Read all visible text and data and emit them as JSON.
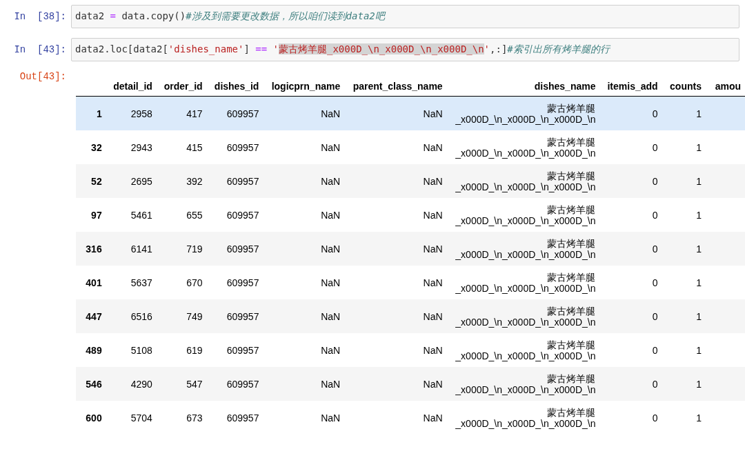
{
  "cells": [
    {
      "prompt": "In  [38]:",
      "code": [
        {
          "kind": "plain",
          "text": "data2 "
        },
        {
          "kind": "op",
          "text": "="
        },
        {
          "kind": "plain",
          "text": " data.copy()"
        },
        {
          "kind": "comment",
          "text": "#涉及到需要更改数据，所以咱们读到data2吧"
        }
      ]
    },
    {
      "prompt": "In  [43]:",
      "code": [
        {
          "kind": "plain",
          "text": "data2.loc[data2["
        },
        {
          "kind": "string",
          "text": "'dishes_name'"
        },
        {
          "kind": "plain",
          "text": "] "
        },
        {
          "kind": "op",
          "text": "=="
        },
        {
          "kind": "string",
          "text": " '"
        },
        {
          "kind": "marked",
          "text": "蒙古烤羊腿_x000D_\\n_x000D_\\n_x000D_\\n"
        },
        {
          "kind": "string",
          "text": "'"
        },
        {
          "kind": "plain",
          "text": ",:]"
        },
        {
          "kind": "comment",
          "text": "#索引出所有烤羊腿的行"
        }
      ]
    }
  ],
  "output": {
    "prompt": "Out[43]:",
    "table": {
      "columns": [
        "",
        "detail_id",
        "order_id",
        "dishes_id",
        "logicprn_name",
        "parent_class_name",
        "dishes_name",
        "itemis_add",
        "counts",
        "amou"
      ],
      "rows": [
        {
          "selected": true,
          "cells": [
            "1",
            "2958",
            "417",
            "609957",
            "NaN",
            "NaN",
            "蒙古烤羊腿\n_x000D_\\n_x000D_\\n_x000D_\\n",
            "0",
            "1"
          ]
        },
        {
          "selected": false,
          "cells": [
            "32",
            "2943",
            "415",
            "609957",
            "NaN",
            "NaN",
            "蒙古烤羊腿\n_x000D_\\n_x000D_\\n_x000D_\\n",
            "0",
            "1"
          ]
        },
        {
          "selected": false,
          "cells": [
            "52",
            "2695",
            "392",
            "609957",
            "NaN",
            "NaN",
            "蒙古烤羊腿\n_x000D_\\n_x000D_\\n_x000D_\\n",
            "0",
            "1"
          ]
        },
        {
          "selected": false,
          "cells": [
            "97",
            "5461",
            "655",
            "609957",
            "NaN",
            "NaN",
            "蒙古烤羊腿\n_x000D_\\n_x000D_\\n_x000D_\\n",
            "0",
            "1"
          ]
        },
        {
          "selected": false,
          "cells": [
            "316",
            "6141",
            "719",
            "609957",
            "NaN",
            "NaN",
            "蒙古烤羊腿\n_x000D_\\n_x000D_\\n_x000D_\\n",
            "0",
            "1"
          ]
        },
        {
          "selected": false,
          "cells": [
            "401",
            "5637",
            "670",
            "609957",
            "NaN",
            "NaN",
            "蒙古烤羊腿\n_x000D_\\n_x000D_\\n_x000D_\\n",
            "0",
            "1"
          ]
        },
        {
          "selected": false,
          "cells": [
            "447",
            "6516",
            "749",
            "609957",
            "NaN",
            "NaN",
            "蒙古烤羊腿\n_x000D_\\n_x000D_\\n_x000D_\\n",
            "0",
            "1"
          ]
        },
        {
          "selected": false,
          "cells": [
            "489",
            "5108",
            "619",
            "609957",
            "NaN",
            "NaN",
            "蒙古烤羊腿\n_x000D_\\n_x000D_\\n_x000D_\\n",
            "0",
            "1"
          ]
        },
        {
          "selected": false,
          "cells": [
            "546",
            "4290",
            "547",
            "609957",
            "NaN",
            "NaN",
            "蒙古烤羊腿\n_x000D_\\n_x000D_\\n_x000D_\\n",
            "0",
            "1"
          ]
        },
        {
          "selected": false,
          "cells": [
            "600",
            "5704",
            "673",
            "609957",
            "NaN",
            "NaN",
            "蒙古烤羊腿\n_x000D_\\n_x000D_\\n_x000D_\\n",
            "0",
            "1"
          ]
        }
      ]
    }
  }
}
